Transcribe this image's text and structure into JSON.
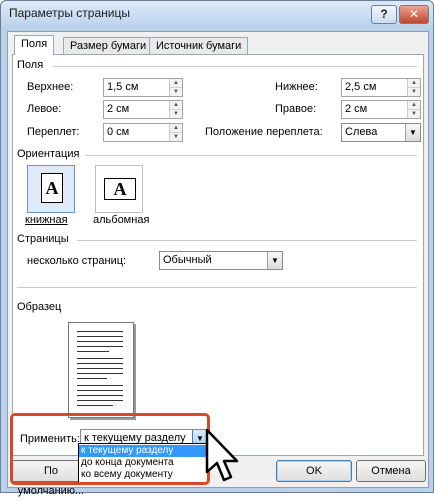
{
  "window": {
    "title": "Параметры страницы",
    "help": "?",
    "close": "✕"
  },
  "tabs": [
    {
      "label": "Поля"
    },
    {
      "label": "Размер бумаги"
    },
    {
      "label": "Источник бумаги"
    }
  ],
  "margins": {
    "section": "Поля",
    "top_label": "Верхнее:",
    "top_value": "1,5 см",
    "bottom_label": "Нижнее:",
    "bottom_value": "2,5 см",
    "left_label": "Левое:",
    "left_value": "2 см",
    "right_label": "Правое:",
    "right_value": "2 см",
    "gutter_label": "Переплет:",
    "gutter_value": "0 см",
    "gutter_pos_label": "Положение переплета:",
    "gutter_pos_value": "Слева"
  },
  "orientation": {
    "section": "Ориентация",
    "portrait_label": "книжная",
    "landscape_label": "альбомная",
    "glyph": "A"
  },
  "pages": {
    "section": "Страницы",
    "multiple_label": "несколько страниц:",
    "multiple_value": "Обычный"
  },
  "preview": {
    "section": "Образец"
  },
  "apply": {
    "label": "Применить:",
    "value": "к текущему разделу",
    "options": [
      "к текущему разделу",
      "до конца документа",
      "ко всему документу"
    ]
  },
  "buttons": {
    "default": "По умолчанию...",
    "ok": "OK",
    "cancel": "Отмена"
  }
}
